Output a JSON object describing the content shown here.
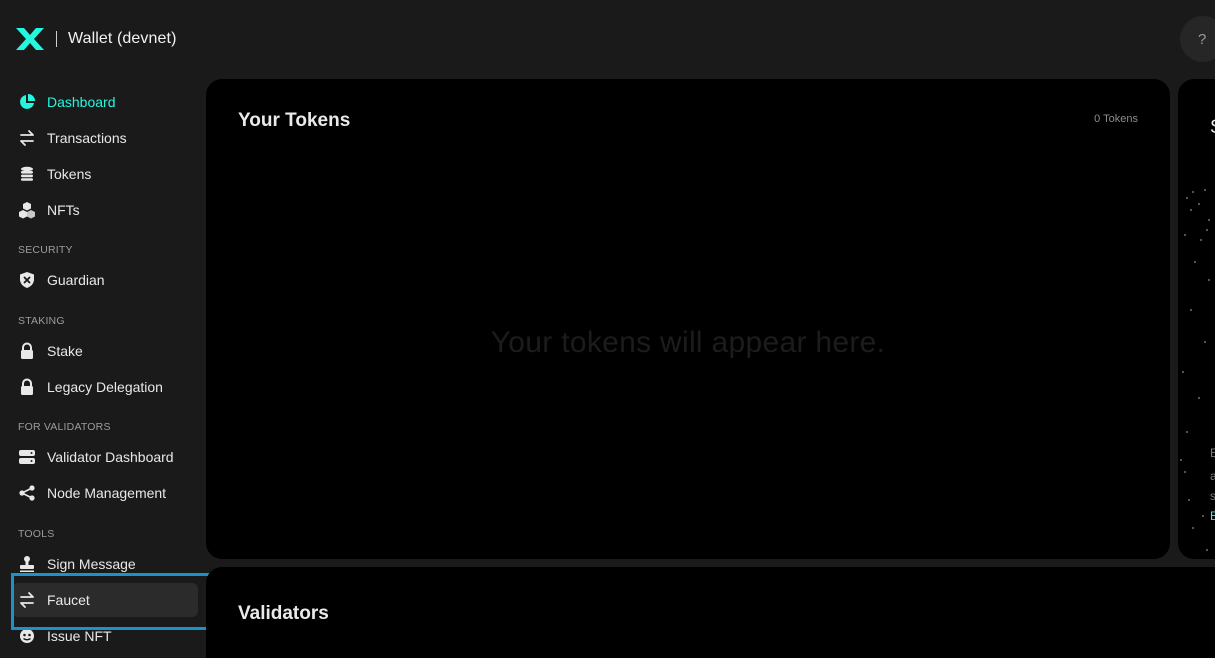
{
  "app": {
    "title": "Wallet (devnet)",
    "help_label": "?"
  },
  "sidebar": {
    "main_items": [
      {
        "label": "Dashboard",
        "icon": "pie-chart-icon",
        "active": true
      },
      {
        "label": "Transactions",
        "icon": "swap-arrows-icon"
      },
      {
        "label": "Tokens",
        "icon": "coins-icon"
      },
      {
        "label": "NFTs",
        "icon": "cubes-icon"
      }
    ],
    "sections": {
      "security": "SECURITY",
      "staking": "STAKING",
      "for_validators": "FOR VALIDATORS",
      "tools": "TOOLS"
    },
    "security_items": [
      {
        "label": "Guardian",
        "icon": "shield-icon"
      }
    ],
    "staking_items": [
      {
        "label": "Stake",
        "icon": "lock-icon"
      },
      {
        "label": "Legacy Delegation",
        "icon": "lock-icon"
      }
    ],
    "validator_items": [
      {
        "label": "Validator Dashboard",
        "icon": "server-icon"
      },
      {
        "label": "Node Management",
        "icon": "share-icon"
      }
    ],
    "tools_items": [
      {
        "label": "Sign Message",
        "icon": "stamp-icon"
      },
      {
        "label": "Faucet",
        "icon": "swap-arrows-icon"
      },
      {
        "label": "Issue NFT",
        "icon": "nft-icon"
      }
    ]
  },
  "tokens_card": {
    "title": "Your Tokens",
    "count": "0 Tokens",
    "empty_message": "Your tokens will appear here."
  },
  "side_card": {
    "title_fragment": "S",
    "text_fragments": [
      "E",
      "a",
      "s"
    ],
    "link_fragment": "E"
  },
  "validators_card": {
    "title": "Validators"
  },
  "colors": {
    "accent": "#23f7dd",
    "background": "#1a1a1a",
    "card": "#000000",
    "focus_outline": "#1b93c9"
  }
}
